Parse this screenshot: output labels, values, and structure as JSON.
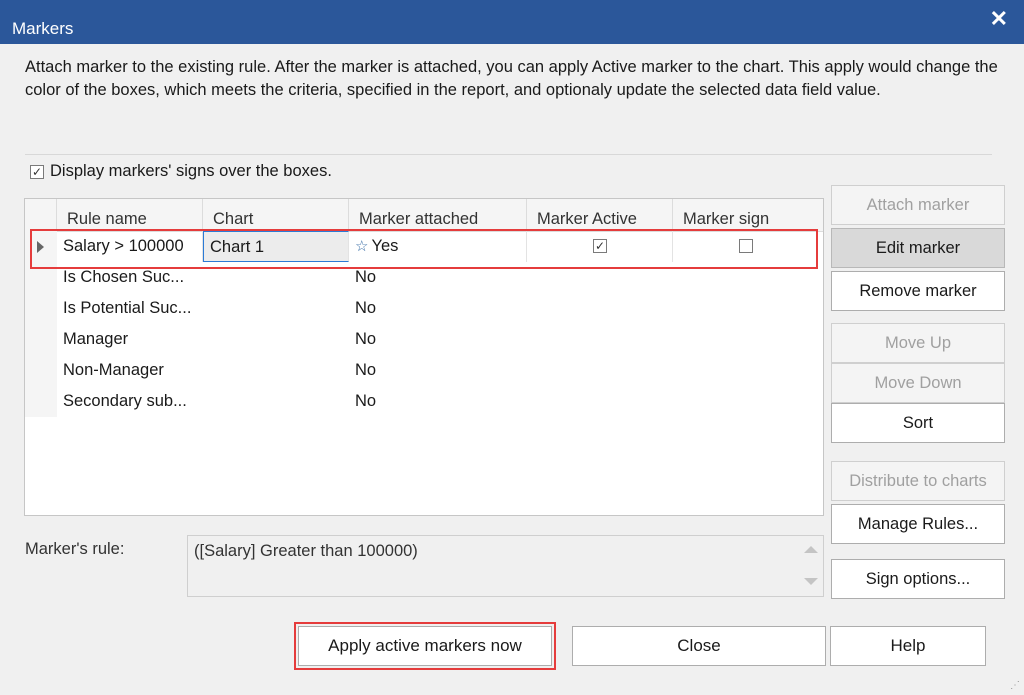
{
  "window": {
    "title": "Markers",
    "close_glyph": "✕"
  },
  "description": "Attach marker to the existing rule. After the marker is attached, you can apply Active marker to the chart. This apply would change the color of the boxes, which meets the criteria, specified in the report, and optionaly update the selected data field value.",
  "display_signs": {
    "label": "Display markers' signs over the boxes.",
    "checked": true
  },
  "grid": {
    "columns": [
      "Rule name",
      "Chart",
      "Marker attached",
      "Marker Active",
      "Marker sign"
    ],
    "rows": [
      {
        "rule": "Salary > 100000",
        "chart": "Chart 1",
        "attached": "Yes",
        "attached_icon": "star-icon",
        "active": true,
        "sign": false,
        "selected": true
      },
      {
        "rule": "Is Chosen Suc...",
        "chart": "",
        "attached": "No"
      },
      {
        "rule": "Is Potential Suc...",
        "chart": "",
        "attached": "No"
      },
      {
        "rule": "Manager",
        "chart": "",
        "attached": "No"
      },
      {
        "rule": "Non-Manager",
        "chart": "",
        "attached": "No"
      },
      {
        "rule": "Secondary sub...",
        "chart": "",
        "attached": "No"
      }
    ]
  },
  "buttons": {
    "attach": "Attach marker",
    "edit": "Edit marker",
    "remove": "Remove  marker",
    "move_up": "Move Up",
    "move_down": "Move Down",
    "sort": "Sort",
    "distribute": "Distribute to charts",
    "manage_rules": "Manage Rules...",
    "sign_options": "Sign options...",
    "apply": "Apply active markers now",
    "close": "Close",
    "help": "Help"
  },
  "marker_rule": {
    "label": "Marker's rule:",
    "value": "([Salary] Greater than 100000)"
  },
  "colors": {
    "titlebar": "#2b579a",
    "highlight": "#e53c3c",
    "focus": "#2b7ad6"
  }
}
